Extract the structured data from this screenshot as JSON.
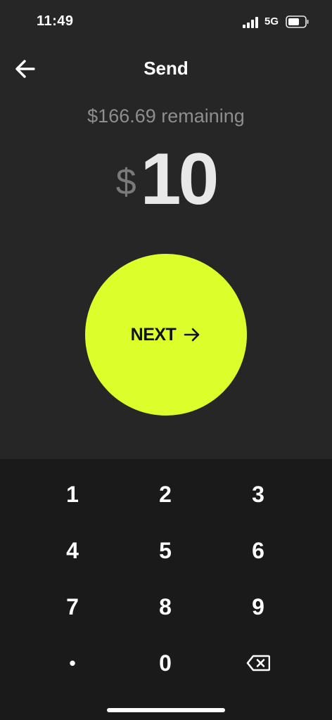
{
  "status_bar": {
    "time": "11:49",
    "network": "5G",
    "icons": [
      "signal-icon",
      "battery-icon"
    ]
  },
  "header": {
    "title": "Send",
    "back_icon": "arrow-left-icon"
  },
  "amount": {
    "remaining": "$166.69 remaining",
    "currency": "$",
    "value": "10"
  },
  "next_button": {
    "label": "NEXT",
    "icon": "arrow-right-icon"
  },
  "keypad": {
    "keys": [
      "1",
      "2",
      "3",
      "4",
      "5",
      "6",
      "7",
      "8",
      "9",
      "•",
      "0"
    ],
    "backspace_icon": "backspace-icon"
  },
  "colors": {
    "accent": "#dcff2b",
    "background_top": "#262626",
    "background_keypad": "#1a1a1a",
    "muted_text": "#8e8e8e"
  }
}
